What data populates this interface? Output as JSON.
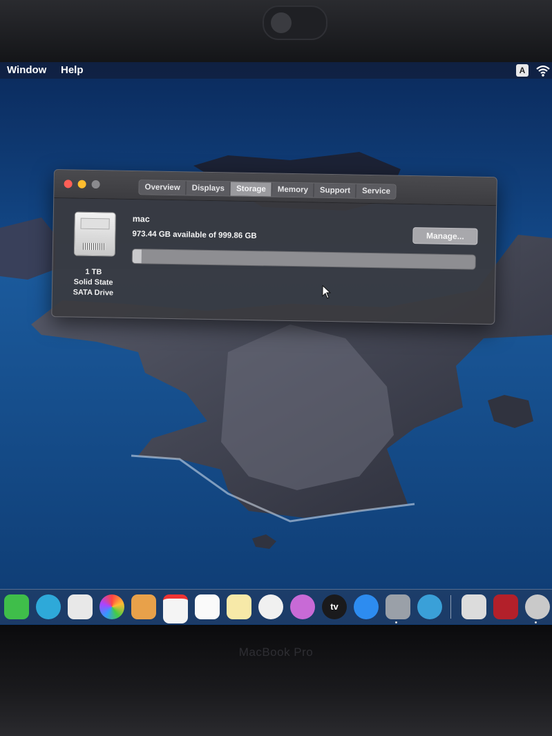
{
  "menubar": {
    "items": [
      "Window",
      "Help"
    ],
    "input_source_label": "A"
  },
  "window": {
    "tabs": [
      "Overview",
      "Displays",
      "Storage",
      "Memory",
      "Support",
      "Service"
    ],
    "active_tab": "Storage",
    "volume": {
      "name": "mac",
      "availability": "973.44 GB available of 999.86 GB",
      "used_fraction": 0.026
    },
    "drive": {
      "capacity": "1 TB",
      "type_line1": "Solid State",
      "type_line2": "SATA Drive"
    },
    "manage_label": "Manage..."
  },
  "dock": {
    "icons": [
      "messages",
      "facetime",
      "maps",
      "photos",
      "contacts",
      "calendar",
      "reminders",
      "notes",
      "music",
      "podcasts",
      "tv",
      "app-store",
      "system-preferences",
      "safari-like",
      "preview",
      "photo-booth",
      "automator"
    ],
    "tv_label": "tv"
  },
  "laptop": {
    "brand": "MacBook Pro"
  },
  "colors": {
    "accent_blue": "#1f5fa3",
    "window_bg": "#3a3a3e",
    "close": "#fe5f57",
    "minimize": "#febc2e"
  }
}
